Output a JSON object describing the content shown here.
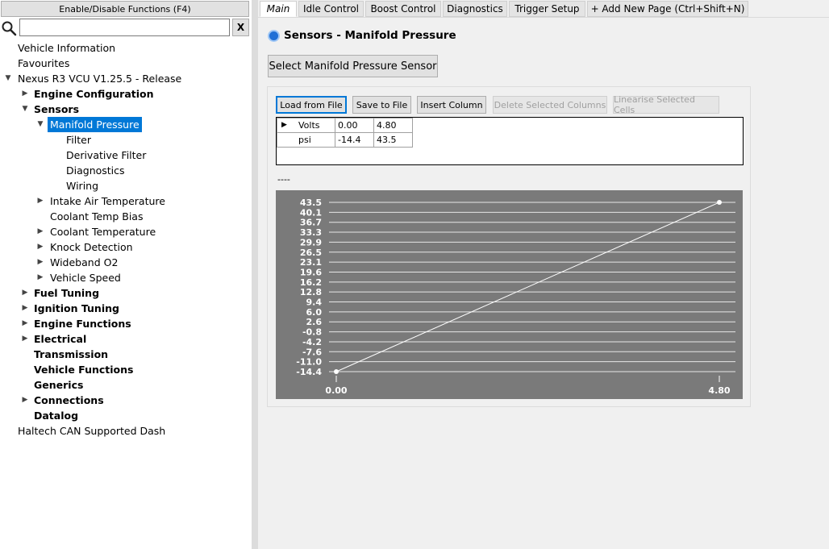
{
  "left_panel": {
    "toggle_button": "Enable/Disable Functions (F4)",
    "search": {
      "placeholder": "",
      "value": ""
    },
    "clear_button": "X",
    "tree": [
      {
        "label": "Vehicle Information",
        "level": 0,
        "arrow": "none",
        "bold": false
      },
      {
        "label": "Favourites",
        "level": 0,
        "arrow": "none",
        "bold": false
      },
      {
        "label": "Nexus R3 VCU V1.25.5 - Release",
        "level": 0,
        "arrow": "down",
        "bold": false
      },
      {
        "label": "Engine Configuration",
        "level": 1,
        "arrow": "right",
        "bold": true
      },
      {
        "label": "Sensors",
        "level": 1,
        "arrow": "down",
        "bold": true
      },
      {
        "label": "Manifold Pressure",
        "level": 2,
        "arrow": "down",
        "bold": false,
        "selected": true
      },
      {
        "label": "Filter",
        "level": 3,
        "arrow": "none",
        "bold": false
      },
      {
        "label": "Derivative Filter",
        "level": 3,
        "arrow": "none",
        "bold": false
      },
      {
        "label": "Diagnostics",
        "level": 3,
        "arrow": "none",
        "bold": false
      },
      {
        "label": "Wiring",
        "level": 3,
        "arrow": "none",
        "bold": false
      },
      {
        "label": "Intake Air Temperature",
        "level": 2,
        "arrow": "right",
        "bold": false
      },
      {
        "label": "Coolant Temp Bias",
        "level": 2,
        "arrow": "none",
        "bold": false
      },
      {
        "label": "Coolant Temperature",
        "level": 2,
        "arrow": "right",
        "bold": false
      },
      {
        "label": "Knock Detection",
        "level": 2,
        "arrow": "right",
        "bold": false
      },
      {
        "label": "Wideband O2",
        "level": 2,
        "arrow": "right",
        "bold": false
      },
      {
        "label": "Vehicle Speed",
        "level": 2,
        "arrow": "right",
        "bold": false
      },
      {
        "label": "Fuel Tuning",
        "level": 1,
        "arrow": "right",
        "bold": true
      },
      {
        "label": "Ignition Tuning",
        "level": 1,
        "arrow": "right",
        "bold": true
      },
      {
        "label": "Engine Functions",
        "level": 1,
        "arrow": "right",
        "bold": true
      },
      {
        "label": "Electrical",
        "level": 1,
        "arrow": "right",
        "bold": true
      },
      {
        "label": "Transmission",
        "level": 1,
        "arrow": "none",
        "bold": true
      },
      {
        "label": "Vehicle Functions",
        "level": 1,
        "arrow": "none",
        "bold": true
      },
      {
        "label": "Generics",
        "level": 1,
        "arrow": "none",
        "bold": true
      },
      {
        "label": "Connections",
        "level": 1,
        "arrow": "right",
        "bold": true
      },
      {
        "label": "Datalog",
        "level": 1,
        "arrow": "none",
        "bold": true
      },
      {
        "label": "Haltech CAN Supported Dash",
        "level": 0,
        "arrow": "none",
        "bold": false
      }
    ]
  },
  "tabs": [
    {
      "label": "Main",
      "active": true
    },
    {
      "label": "Idle Control",
      "active": false
    },
    {
      "label": "Boost Control",
      "active": false
    },
    {
      "label": "Diagnostics",
      "active": false
    },
    {
      "label": "Trigger Setup",
      "active": false
    },
    {
      "label": "+ Add New Page (Ctrl+Shift+N)",
      "active": false
    }
  ],
  "page": {
    "title": "Sensors - Manifold Pressure",
    "select_sensor_button": "Select Manifold Pressure Sensor",
    "toolbar": {
      "load": "Load from File",
      "save": "Save to File",
      "insert": "Insert Column",
      "delete": "Delete Selected Columns",
      "linearise": "Linearise Selected Cells"
    },
    "table": {
      "rows": [
        {
          "label": "Volts",
          "values": [
            "0.00",
            "4.80"
          ]
        },
        {
          "label": "psi",
          "values": [
            "-14.4",
            "43.5"
          ]
        }
      ]
    },
    "status_text": "----"
  },
  "chart_data": {
    "type": "line",
    "x": [
      0.0,
      4.8
    ],
    "y": [
      -14.4,
      43.5
    ],
    "x_tick_labels": [
      "0.00",
      "4.80"
    ],
    "y_tick_labels": [
      "43.5",
      "40.1",
      "36.7",
      "33.3",
      "29.9",
      "26.5",
      "23.1",
      "19.6",
      "16.2",
      "12.8",
      "9.4",
      "6.0",
      "2.6",
      "-0.8",
      "-4.2",
      "-7.6",
      "-11.0",
      "-14.4"
    ],
    "ylim": [
      -14.4,
      43.5
    ],
    "xlim": [
      0.0,
      4.8
    ],
    "title": "",
    "xlabel": "",
    "ylabel": "",
    "grid": true,
    "colors": {
      "background": "#7a7a7a",
      "line": "#ffffff",
      "grid": "#e6e6e6"
    }
  }
}
